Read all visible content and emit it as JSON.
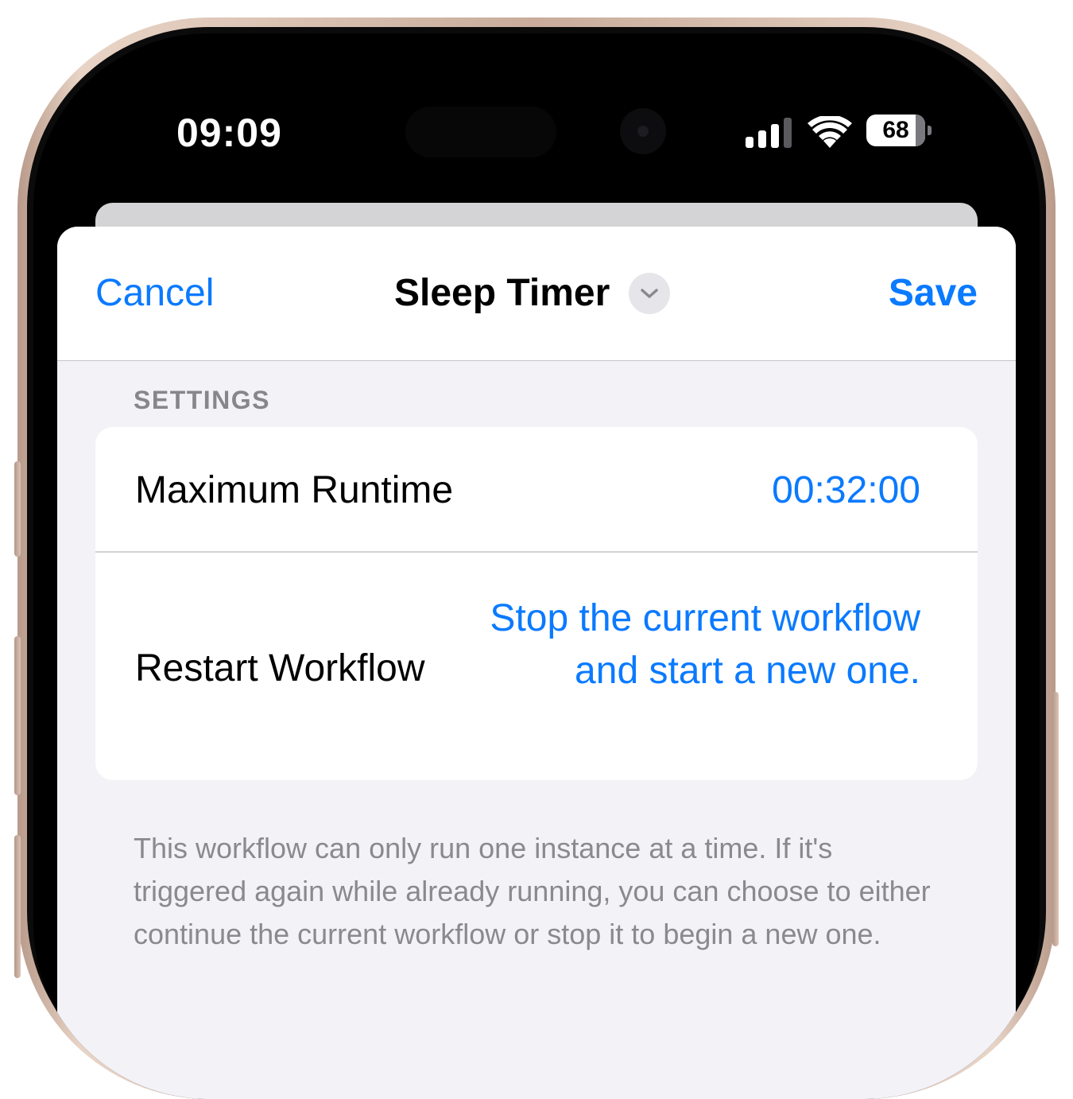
{
  "status_bar": {
    "time": "09:09",
    "battery_percent": "68",
    "signal_icon": "cellular-signal-icon",
    "wifi_icon": "wifi-icon",
    "battery_icon": "battery-icon"
  },
  "nav": {
    "cancel_label": "Cancel",
    "title": "Sleep Timer",
    "save_label": "Save",
    "title_menu_icon": "chevron-down-icon"
  },
  "settings": {
    "header": "SETTINGS",
    "rows": [
      {
        "label": "Maximum Runtime",
        "value": "00:32:00"
      },
      {
        "label": "Restart Workflow",
        "value": "Stop the current workflow and start a new one."
      }
    ],
    "footer": "This workflow can only run one instance at a time. If it's triggered again while already running, you can choose to either continue the current workflow or stop it to begin a new one."
  },
  "colors": {
    "accent": "#0a7aff",
    "secondary_text": "#8a8a8e",
    "grouped_background": "#f2f2f7",
    "frame": "#d9bfae"
  }
}
